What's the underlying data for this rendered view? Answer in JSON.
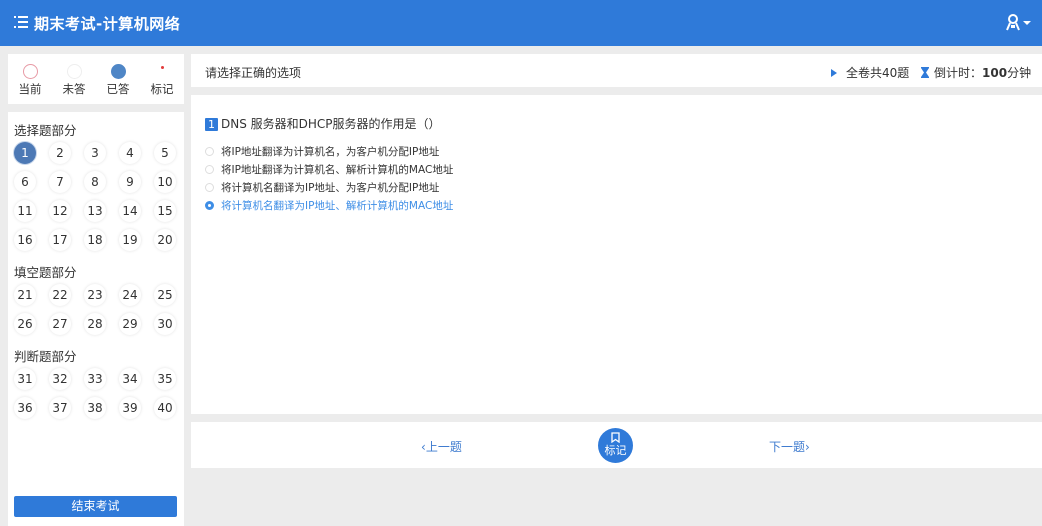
{
  "header": {
    "title": "期末考试-计算机网络",
    "menu_icon": "list-menu-icon",
    "user_icon": "user-icon"
  },
  "legend": {
    "current": "当前",
    "unanswered": "未答",
    "answered": "已答",
    "flagged": "标记"
  },
  "nav": {
    "sections": [
      {
        "title": "选择题部分",
        "questions": [
          "1",
          "2",
          "3",
          "4",
          "5",
          "6",
          "7",
          "8",
          "9",
          "10",
          "11",
          "12",
          "13",
          "14",
          "15",
          "16",
          "17",
          "18",
          "19",
          "20"
        ]
      },
      {
        "title": "填空题部分",
        "questions": [
          "21",
          "22",
          "23",
          "24",
          "25",
          "26",
          "27",
          "28",
          "29",
          "30"
        ]
      },
      {
        "title": "判断题部分",
        "questions": [
          "31",
          "32",
          "33",
          "34",
          "35",
          "36",
          "37",
          "38",
          "39",
          "40"
        ]
      }
    ],
    "active_question": "1",
    "end_button": "结束考试"
  },
  "info": {
    "instruction": "请选择正确的选项",
    "total": "全卷共40题",
    "timer_label": "倒计时：",
    "timer_value": "100",
    "timer_unit": "分钟"
  },
  "question": {
    "number": "1",
    "text": "DNS 服务器和DHCP服务器的作用是（）",
    "options": [
      "将IP地址翻译为计算机名，为客户机分配IP地址",
      "将IP地址翻译为计算机名、解析计算机的MAC地址",
      "将计算机名翻译为IP地址、为客户机分配IP地址",
      "将计算机名翻译为IP地址、解析计算机的MAC地址"
    ],
    "selected_option": "4"
  },
  "footer": {
    "prev": "上一题",
    "flag": "标记",
    "next": "下一题"
  },
  "colors": {
    "primary": "#2f7ad9",
    "answered": "#4f86c6",
    "selected_option": "#3e8ee6"
  }
}
